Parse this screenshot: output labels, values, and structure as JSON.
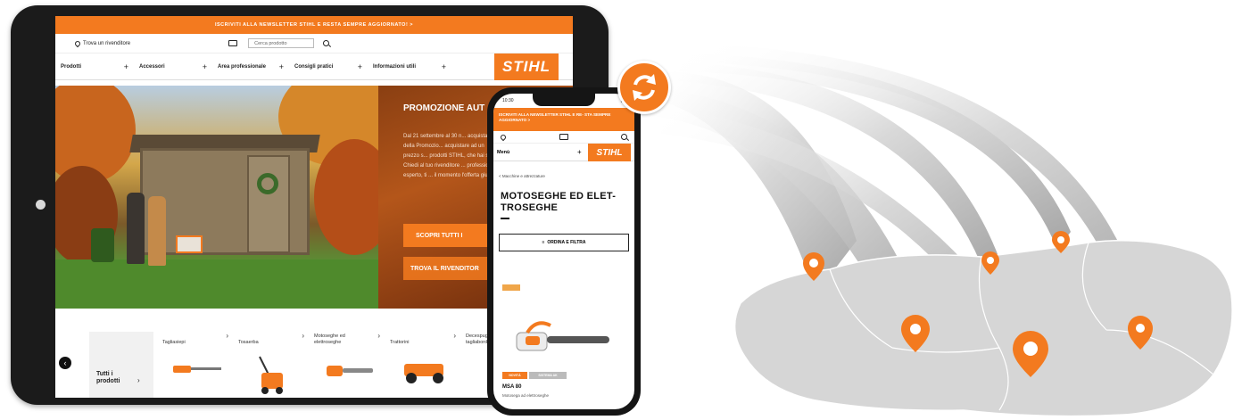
{
  "tablet": {
    "banner": "ISCRIVITI ALLA NEWSLETTER STIHL E RESTA SEMPRE AGGIORNATO!  >",
    "dealer_label": "Trova un rivenditore",
    "search_placeholder": "Cerca prodotto",
    "nav": [
      "Prodotti",
      "Accessori",
      "Area professionale",
      "Consigli pratici",
      "Informazioni utili"
    ],
    "logo": "STIHL",
    "promo": {
      "title": "PROMOZIONE AUT",
      "text": "Dal 21 settembre al 30 n... acquistate della Promozio... acquistare ad un prezzo s... prodotti STIHL, che hai sc... Chiedi al tuo rivenditore ... professionale esperto, ti ... il momento l'offerta giu...",
      "button_primary": "SCOPRI TUTTI I",
      "button_secondary": "TROVA IL RIVENDITOR"
    },
    "all_products": "Tutti i prodotti",
    "categories": [
      "Tagliasiepi",
      "Tosaerba",
      "Motoseghe ed elettroseghe",
      "Trattorini",
      "Decespugliatori e tagliabordi"
    ]
  },
  "phone": {
    "time": "10:30",
    "banner": "ISCRIVITI ALLA NEWSLETTER STIHL E RE- STA SEMPRE AGGIORNATO  >",
    "menu": "Menù",
    "logo": "STIHL",
    "breadcrumb": "< Macchine e attrezzature",
    "title": "MOTOSEGHE ED ELET- TROSEGHE",
    "filter": "ORDINA E FILTRA",
    "chip_primary": "NOVITÀ",
    "chip_secondary": "SISTEMA AK",
    "product_name": "MSA 80",
    "product_sub": "Motosega ad elettroseghe"
  },
  "colors": {
    "brand": "#f37a1f",
    "pin": "#f37a1f",
    "map": "#d9d9d9"
  },
  "icons": [
    "location-pin-icon",
    "catalog-icon",
    "search-icon",
    "sync-icon",
    "chevron-left-icon",
    "chevron-right-icon"
  ]
}
